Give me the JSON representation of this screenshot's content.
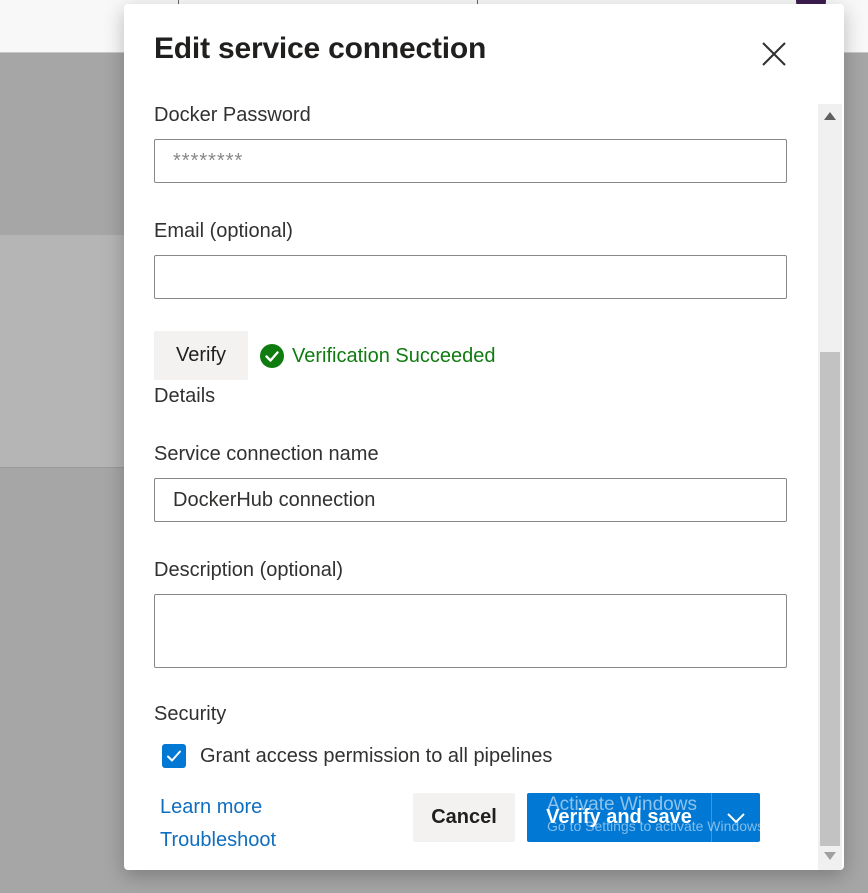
{
  "dialog": {
    "title": "Edit service connection"
  },
  "form": {
    "docker_password": {
      "label": "Docker Password",
      "placeholder": "********"
    },
    "email": {
      "label": "Email (optional)",
      "value": ""
    },
    "verify_button": "Verify",
    "verify_status": "Verification Succeeded",
    "details_heading": "Details",
    "service_connection_name": {
      "label": "Service connection name",
      "value": "DockerHub connection"
    },
    "description": {
      "label": "Description (optional)",
      "value": ""
    },
    "security_heading": "Security",
    "grant_access": {
      "label": "Grant access permission to all pipelines",
      "checked": true
    }
  },
  "footer": {
    "learn_more": "Learn more",
    "troubleshoot": "Troubleshoot",
    "cancel": "Cancel",
    "verify_and_save": "Verify and save"
  },
  "watermark": {
    "line1": "Activate Windows",
    "line2": "Go to Settings to activate Windows."
  },
  "colors": {
    "primary": "#0078d4",
    "success": "#107c10",
    "link": "#106ebe"
  },
  "icons": {
    "close": "close-icon",
    "success": "check-circle-icon",
    "checkbox": "checkmark-icon",
    "split": "chevron-down-icon"
  }
}
